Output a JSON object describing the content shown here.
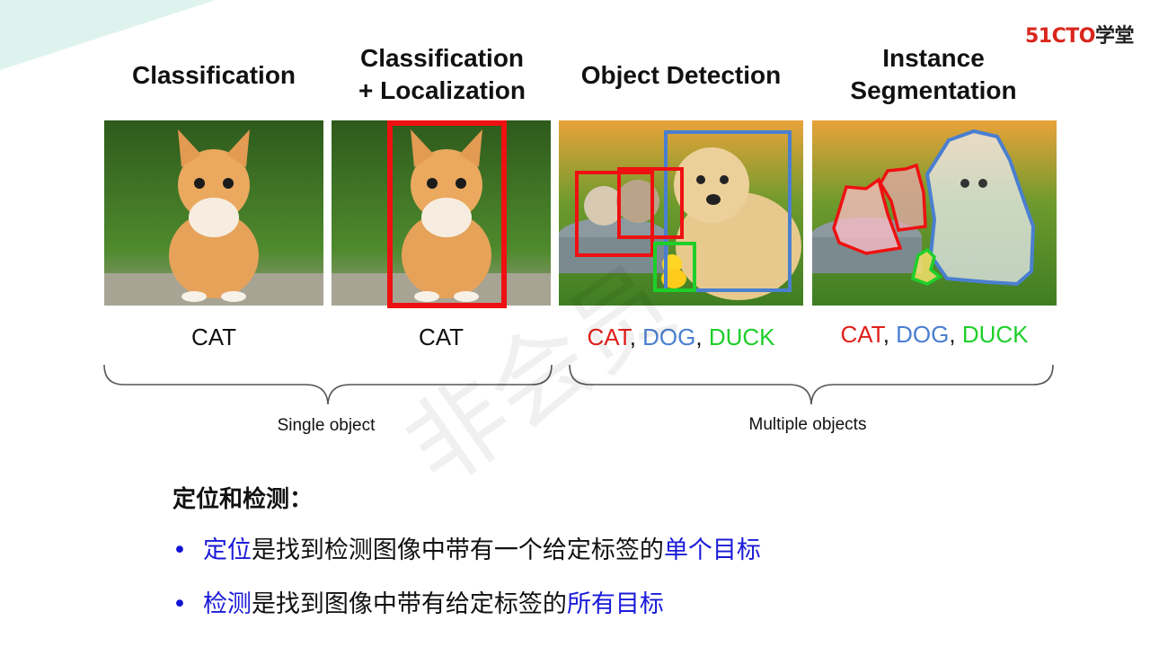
{
  "logo": {
    "num": "51CTO",
    "cn": "学堂"
  },
  "titles": {
    "classification": "Classification",
    "cls_loc_1": "Classification",
    "cls_loc_2": "+ Localization",
    "detection": "Object Detection",
    "seg_1": "Instance",
    "seg_2": "Segmentation"
  },
  "labels": {
    "cat1": "CAT",
    "cat2": "CAT",
    "det": {
      "cat": "CAT",
      "dog": "DOG",
      "duck": "DUCK",
      "sep": ", "
    },
    "seg": {
      "cat": "CAT",
      "dog": "DOG",
      "duck": "DUCK",
      "sep": ", "
    }
  },
  "groups": {
    "single": "Single object",
    "multiple": "Multiple objects"
  },
  "watermark": "非会员",
  "section": {
    "heading": "定位和检测：",
    "bullet1": {
      "term": "定位",
      "mid": "是找到检测图像中带有一个给定标签的",
      "end": "单个目标"
    },
    "bullet2": {
      "term": "检测",
      "mid": "是找到图像中带有给定标签的",
      "end": "所有目标"
    },
    "bullet_symbol": "•"
  },
  "colors": {
    "cat": "#e0201b",
    "dog": "#4a7fd0",
    "duck": "#1ecf2a",
    "highlight": "#1a1ad8",
    "logo_red": "#d9261c"
  }
}
